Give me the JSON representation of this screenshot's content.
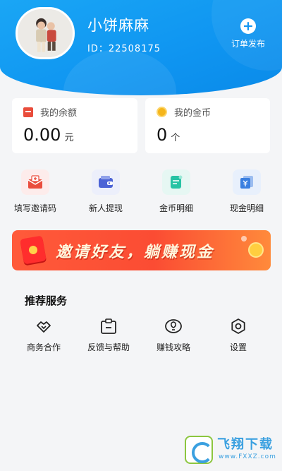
{
  "profile": {
    "name": "小饼麻麻",
    "id_text": "ID：22508175",
    "publish_label": "订单发布"
  },
  "cards": {
    "balance": {
      "label": "我的余额",
      "amount": "0.00",
      "unit": "元"
    },
    "coins": {
      "label": "我的金币",
      "amount": "0",
      "unit": "个"
    }
  },
  "quick_actions": [
    {
      "label": "填写邀请码",
      "icon": "invite-code-icon",
      "color": "#ea4d3d"
    },
    {
      "label": "新人提现",
      "icon": "wallet-icon",
      "color": "#4b63d6"
    },
    {
      "label": "金币明细",
      "icon": "coin-detail-icon",
      "color": "#27c3a4"
    },
    {
      "label": "现金明细",
      "icon": "cash-detail-icon",
      "color": "#3a7fe0"
    }
  ],
  "banner": {
    "text": "邀请好友，躺赚现金"
  },
  "services": {
    "title": "推荐服务",
    "items": [
      {
        "label": "商务合作",
        "icon": "handshake-icon"
      },
      {
        "label": "反馈与帮助",
        "icon": "feedback-icon"
      },
      {
        "label": "赚钱攻略",
        "icon": "strategy-icon"
      },
      {
        "label": "设置",
        "icon": "settings-icon"
      }
    ]
  },
  "watermark": {
    "title": "飞翔下载",
    "url": "www.FXXZ.com"
  }
}
